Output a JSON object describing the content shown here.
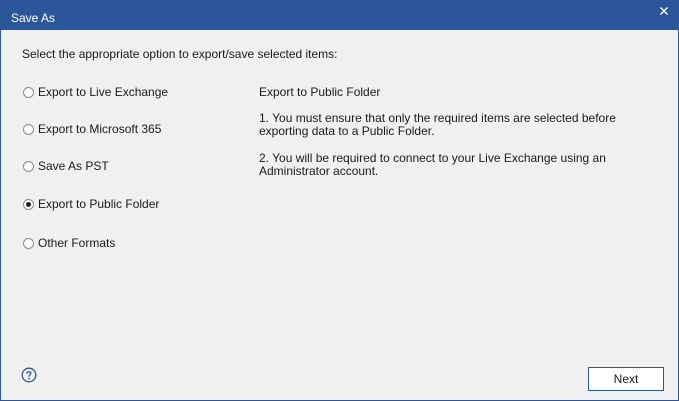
{
  "window": {
    "title": "Save As"
  },
  "instruction": "Select the appropriate option to export/save selected items:",
  "options": [
    {
      "label": "Export to Live Exchange",
      "selected": false
    },
    {
      "label": "Export to Microsoft 365",
      "selected": false
    },
    {
      "label": "Save As PST",
      "selected": false
    },
    {
      "label": "Export to Public Folder",
      "selected": true
    },
    {
      "label": "Other Formats",
      "selected": false
    }
  ],
  "description": {
    "title": "Export to Public Folder",
    "point1": "1. You must ensure that only the required items are selected before exporting data to a Public Folder.",
    "point2": "2. You will be required to connect to your Live Exchange using an Administrator account."
  },
  "footer": {
    "next_label": "Next",
    "help_icon": "question-circle-icon"
  },
  "colors": {
    "titlebar": "#2b579a",
    "background": "#f0f0f0",
    "accent": "#2b579a"
  }
}
